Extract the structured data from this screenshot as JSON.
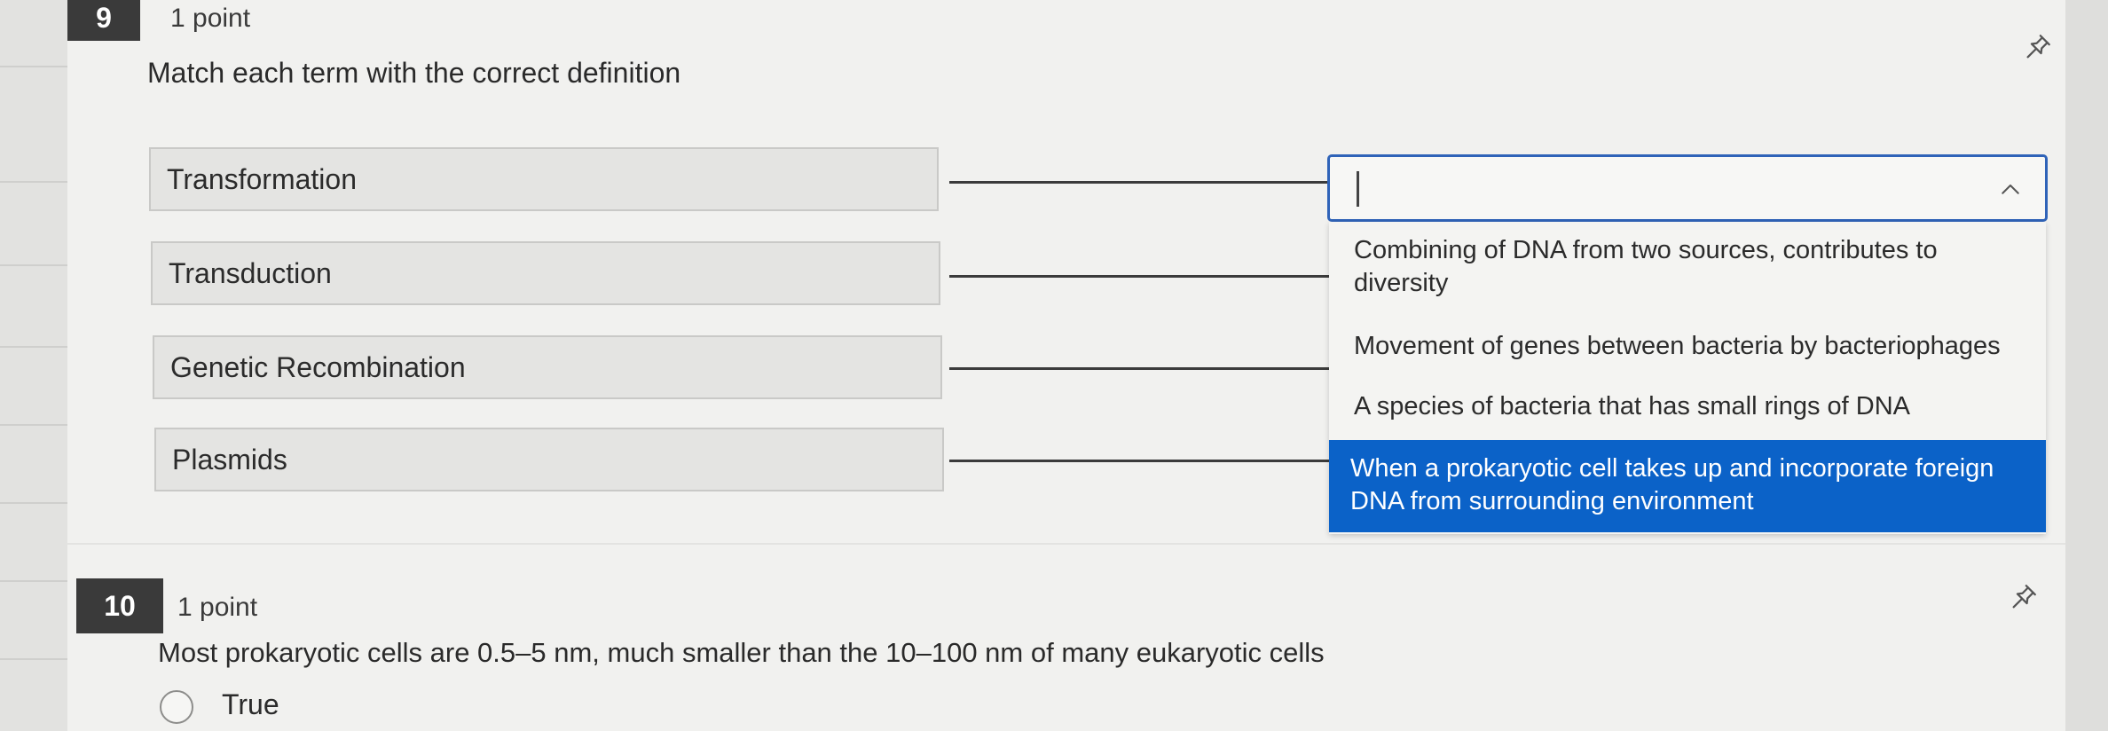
{
  "question9": {
    "number": "9",
    "points": "1 point",
    "prompt": "Match each term with the correct definition",
    "terms": [
      "Transformation",
      "Transduction",
      "Genetic Recombination",
      "Plasmids"
    ],
    "dropdown": {
      "value": "",
      "options": [
        "Combining of DNA from two sources, contributes to diversity",
        "Movement of genes between bacteria by bacteriophages",
        "A species of bacteria that has small rings of DNA",
        "When a prokaryotic cell takes up and incorporate foreign DNA from surrounding environment"
      ],
      "highlighted_index": 3
    }
  },
  "question10": {
    "number": "10",
    "points": "1 point",
    "prompt": "Most prokaryotic cells are 0.5–5 nm, much smaller than the 10–100 nm of many eukaryotic cells",
    "options": [
      "True"
    ]
  },
  "icons": {
    "pin": "pin-icon",
    "chevron": "chevron-up-icon",
    "radio": "radio-button-icon"
  },
  "colors": {
    "accent": "#0b62c8",
    "focus_border": "#2f63b8",
    "number_badge": "#3a3a3a"
  }
}
